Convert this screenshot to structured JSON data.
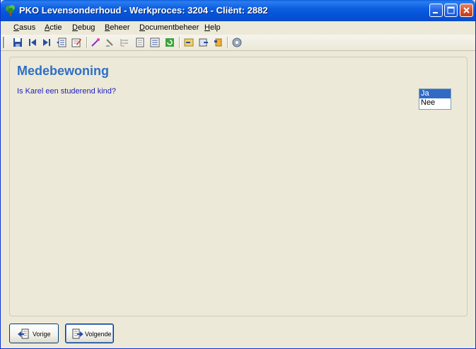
{
  "window": {
    "title": "PKO Levensonderhoud - Werkproces: 3204 - Cliënt: 2882"
  },
  "menu": {
    "items": [
      {
        "mnemonic": "C",
        "rest": "asus"
      },
      {
        "mnemonic": "A",
        "rest": "ctie"
      },
      {
        "mnemonic": "D",
        "rest": "ebug"
      },
      {
        "mnemonic": "B",
        "rest": "eheer"
      },
      {
        "mnemonic": "D",
        "rest": "ocumentbeheer"
      },
      {
        "mnemonic": "H",
        "rest": "elp"
      }
    ]
  },
  "main": {
    "heading": "Medebewoning",
    "question": "Is Karel een studerend kind?",
    "options": [
      "Ja",
      "Nee"
    ],
    "selected_option": "Ja"
  },
  "nav": {
    "prev_label": "Vorige",
    "next_label": "Volgende"
  },
  "colors": {
    "heading": "#2f6ec6",
    "question": "#2020c0",
    "selection": "#316ac5",
    "titlebar": "#0553d8"
  }
}
